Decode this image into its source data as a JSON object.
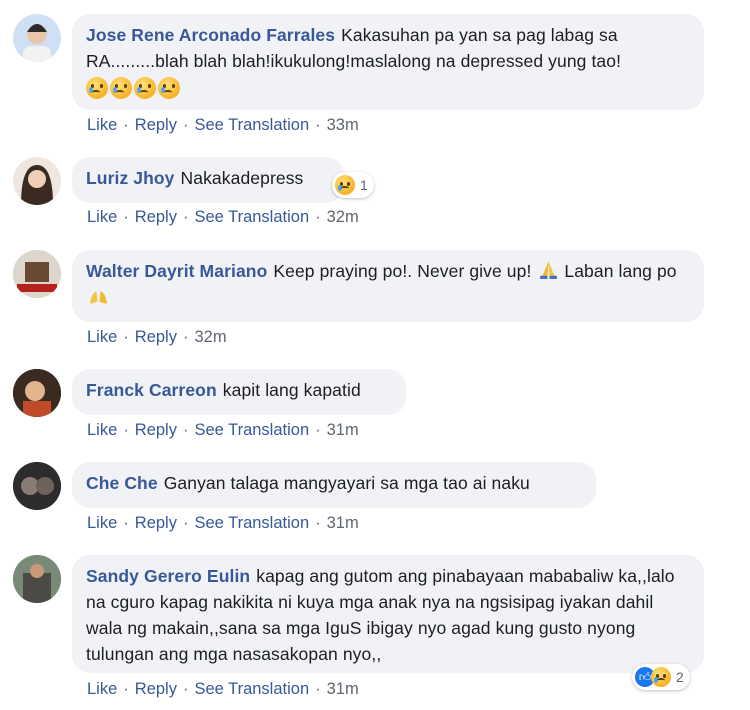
{
  "actions": {
    "like": "Like",
    "reply": "Reply",
    "see_translation": "See Translation"
  },
  "comments": [
    {
      "author": "Jose Rene Arconado Farrales",
      "text": "Kakasuhan pa yan sa pag labag sa RA.........blah blah blah!ikukulong!maslalong na depressed yung tao!",
      "time": "33m"
    },
    {
      "author": "Luriz Jhoy",
      "text": "Nakakadepress",
      "time": "32m",
      "reaction_count": "1"
    },
    {
      "author": "Walter Dayrit Mariano",
      "text": "Keep praying po!. Never give up!",
      "text2": "Laban lang po",
      "time": "32m"
    },
    {
      "author": "Franck Carreon",
      "text": "kapit lang kapatid",
      "time": "31m"
    },
    {
      "author": "Che Che",
      "text": "Ganyan talaga mangyayari sa mga tao ai naku",
      "time": "31m"
    },
    {
      "author": "Sandy Gerero Eulin",
      "text": "kapag ang gutom ang pinabayaan mababaliw ka,,lalo na cguro kapag nakikita ni kuya mga anak nya na ngsisipag iyakan dahil wala ng makain,,sana sa mga IguS ibigay nyo agad kung gusto nyong tulungan ang mga nasasakopan nyo,,",
      "time": "31m",
      "reaction_count": "2"
    }
  ],
  "colors": {
    "link": "#385898",
    "bubble": "#f0f2f5",
    "meta": "#606770"
  }
}
